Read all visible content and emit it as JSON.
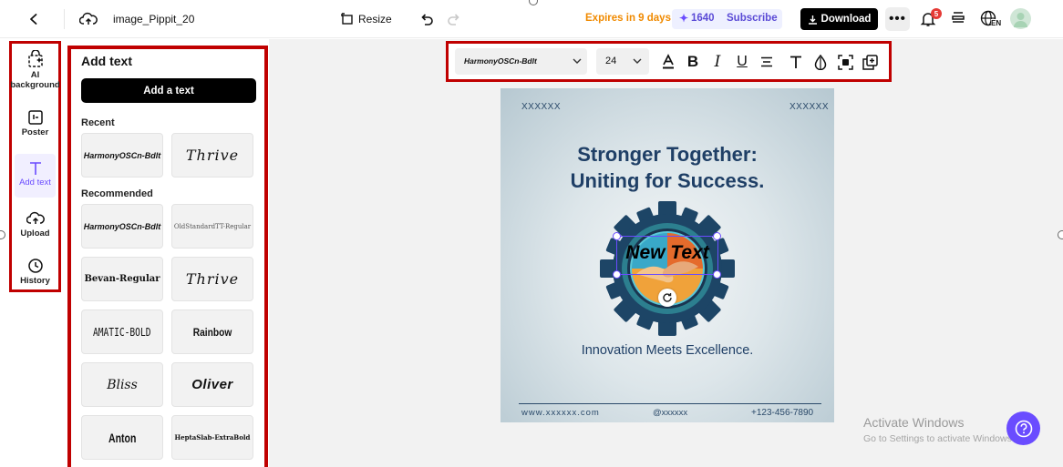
{
  "topbar": {
    "file_name": "image_Pippit_20",
    "resize_label": "Resize",
    "expires_text": "Expires in 9 days",
    "credits": "1640",
    "subscribe_label": "Subscribe",
    "download_label": "Download",
    "notification_count": "5",
    "language": "EN"
  },
  "rail": {
    "items": [
      {
        "label": "AI background"
      },
      {
        "label": "Poster"
      },
      {
        "label": "Add text"
      },
      {
        "label": "Upload"
      },
      {
        "label": "History"
      }
    ]
  },
  "panel": {
    "title": "Add text",
    "add_button": "Add a text",
    "recent_heading": "Recent",
    "recent": [
      "HarmonyOSCn-Bdlt",
      "Thrive"
    ],
    "recommended_heading": "Recommended",
    "recommended": [
      "HarmonyOSCn-Bdlt",
      "OldStandardTT-Regular",
      "Bevan-Regular",
      "Thrive",
      "AMATIC-BOLD",
      "Rainbow",
      "Bliss",
      "Oliver",
      "Anton",
      "HeptaSlab-ExtraBold"
    ]
  },
  "toolbar": {
    "font_name": "HarmonyOSCn-Bdlt",
    "font_size": "24"
  },
  "poster": {
    "corner_left": "XXXXXX",
    "corner_right": "XXXXXX",
    "headline_1": "Stronger Together:",
    "headline_2": "Uniting for Success.",
    "overlay_text": "New Text",
    "tagline": "Innovation Meets Excellence.",
    "footer_web": "www.xxxxxx.com",
    "footer_handle": "@xxxxxx",
    "footer_phone": "+123-456-7890"
  },
  "watermark": {
    "line1": "Activate Windows",
    "line2": "Go to Settings to activate Windows."
  },
  "colors": {
    "accent_red": "#c00000",
    "brand_purple": "#6a4cff",
    "poster_navy": "#1f3f66",
    "expires_orange": "#f08a00"
  }
}
